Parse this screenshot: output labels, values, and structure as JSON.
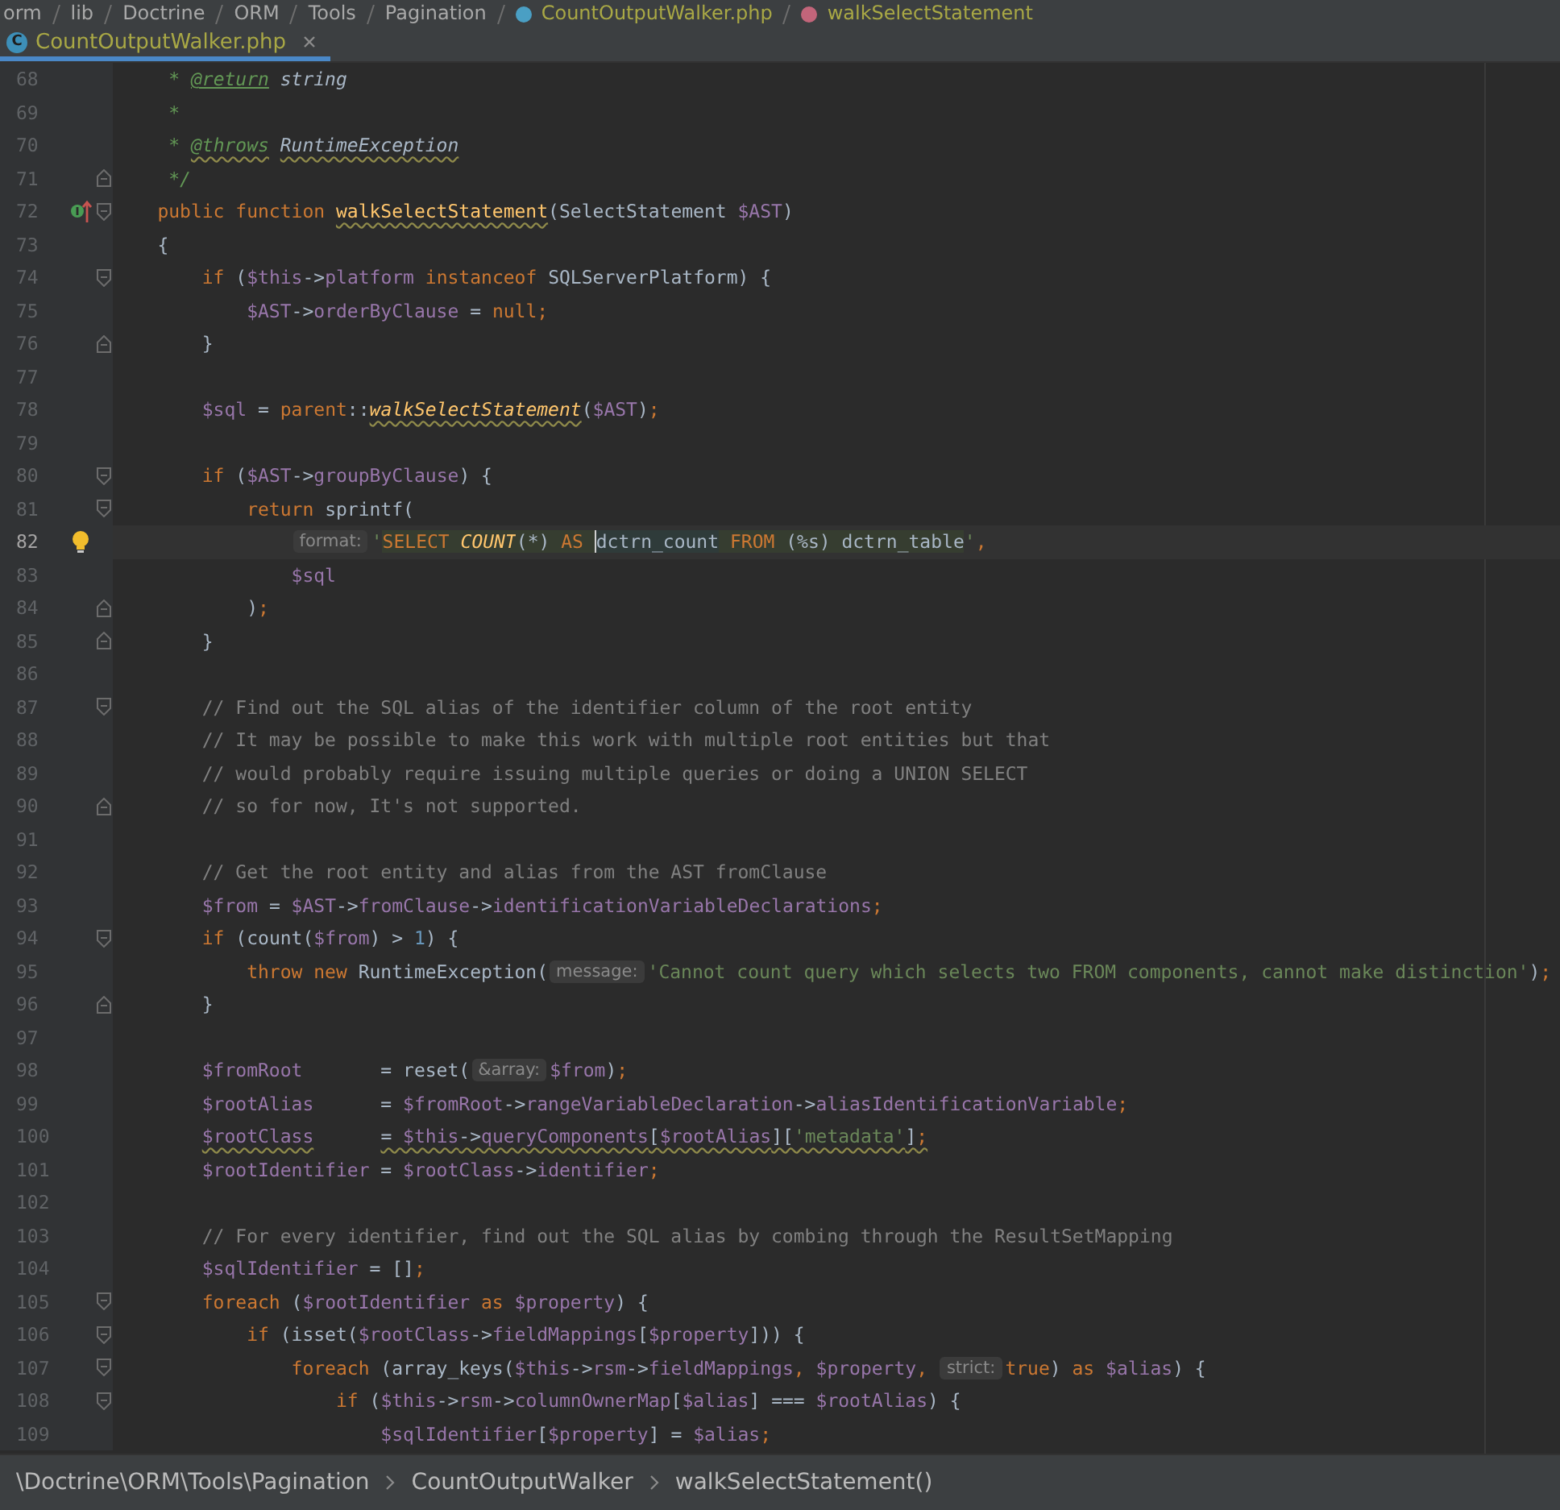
{
  "navigation_bar": {
    "items": [
      {
        "label": "orm",
        "kind": "folder"
      },
      {
        "label": "lib",
        "kind": "folder"
      },
      {
        "label": "Doctrine",
        "kind": "folder"
      },
      {
        "label": "ORM",
        "kind": "folder"
      },
      {
        "label": "Tools",
        "kind": "folder"
      },
      {
        "label": "Pagination",
        "kind": "folder"
      },
      {
        "label": "CountOutputWalker.php",
        "kind": "file"
      },
      {
        "label": "walkSelectStatement",
        "kind": "method"
      }
    ]
  },
  "tabs": [
    {
      "label": "CountOutputWalker.php",
      "icon_letter": "C",
      "selected": true
    }
  ],
  "editor": {
    "lines": [
      {
        "number": "68",
        "tokens": [
          {
            "kind": "doc",
            "text": "     * "
          },
          {
            "kind": "doctag",
            "text": "@return"
          },
          {
            "kind": "doctype",
            "text": " string"
          }
        ]
      },
      {
        "number": "69",
        "tokens": [
          {
            "kind": "doc",
            "text": "     *"
          }
        ]
      },
      {
        "number": "70",
        "tokens": [
          {
            "kind": "doc",
            "text": "     * "
          },
          {
            "kind": "doctag",
            "text": "@throws",
            "warning": true
          },
          {
            "kind": "doctype",
            "text": " RuntimeException",
            "warning": true
          }
        ]
      },
      {
        "number": "71",
        "fold_end": true,
        "tokens": [
          {
            "kind": "doc",
            "text": "     */"
          }
        ]
      },
      {
        "number": "72",
        "fold_start": true,
        "implements_marker": true,
        "tokens": [
          {
            "kind": "keyword",
            "text": "    public function "
          },
          {
            "kind": "declaration",
            "text": "walkSelectStatement",
            "warning": true
          },
          {
            "kind": "plain",
            "text": "(SelectStatement "
          },
          {
            "kind": "variable",
            "text": "$AST"
          },
          {
            "kind": "plain",
            "text": ")"
          }
        ]
      },
      {
        "number": "73",
        "tokens": [
          {
            "kind": "plain",
            "text": "    {"
          }
        ]
      },
      {
        "number": "74",
        "fold_start": true,
        "tokens": [
          {
            "kind": "keyword",
            "text": "        if "
          },
          {
            "kind": "plain",
            "text": "("
          },
          {
            "kind": "variable",
            "text": "$this"
          },
          {
            "kind": "plain",
            "text": "->"
          },
          {
            "kind": "field",
            "text": "platform"
          },
          {
            "kind": "keyword",
            "text": " instanceof "
          },
          {
            "kind": "plain",
            "text": "SQLServerPlatform) {"
          }
        ]
      },
      {
        "number": "75",
        "tokens": [
          {
            "kind": "variable",
            "text": "            $AST"
          },
          {
            "kind": "plain",
            "text": "->"
          },
          {
            "kind": "field",
            "text": "orderByClause"
          },
          {
            "kind": "plain",
            "text": " = "
          },
          {
            "kind": "keyword",
            "text": "null"
          },
          {
            "kind": "punct",
            "text": ";"
          }
        ]
      },
      {
        "number": "76",
        "fold_end": true,
        "tokens": [
          {
            "kind": "plain",
            "text": "        }"
          }
        ]
      },
      {
        "number": "77"
      },
      {
        "number": "78",
        "tokens": [
          {
            "kind": "variable",
            "text": "        $sql"
          },
          {
            "kind": "plain",
            "text": " = "
          },
          {
            "kind": "keyword",
            "text": "parent"
          },
          {
            "kind": "plain",
            "text": "::"
          },
          {
            "kind": "call",
            "text": "walkSelectStatement",
            "warning": true
          },
          {
            "kind": "plain",
            "text": "("
          },
          {
            "kind": "variable",
            "text": "$AST"
          },
          {
            "kind": "plain",
            "text": ")"
          },
          {
            "kind": "punct",
            "text": ";"
          }
        ]
      },
      {
        "number": "79"
      },
      {
        "number": "80",
        "fold_start": true,
        "tokens": [
          {
            "kind": "keyword",
            "text": "        if "
          },
          {
            "kind": "plain",
            "text": "("
          },
          {
            "kind": "variable",
            "text": "$AST"
          },
          {
            "kind": "plain",
            "text": "->"
          },
          {
            "kind": "field",
            "text": "groupByClause"
          },
          {
            "kind": "plain",
            "text": ") {"
          }
        ]
      },
      {
        "number": "81",
        "fold_start": true,
        "tokens": [
          {
            "kind": "keyword",
            "text": "            return "
          },
          {
            "kind": "plain",
            "text": "sprintf("
          }
        ]
      },
      {
        "number": "82",
        "current": true,
        "intention_bulb": true,
        "tokens": [
          {
            "kind": "hint",
            "text": "format:"
          },
          {
            "kind": "string",
            "text": "'"
          },
          {
            "kind": "sqlkeyword",
            "text": "SELECT"
          },
          {
            "kind": "sqlfunction",
            "text": " COUNT"
          },
          {
            "kind": "sqltext",
            "text": "(*) "
          },
          {
            "kind": "sqlkeyword",
            "text": "AS "
          },
          {
            "kind": "sqlalias",
            "text": "dctrn_count",
            "caret": true
          },
          {
            "kind": "sqlkeyword",
            "text": " FROM"
          },
          {
            "kind": "sqltext",
            "text": " (%s) dctrn_table"
          },
          {
            "kind": "string",
            "text": "'"
          },
          {
            "kind": "punct",
            "text": ","
          }
        ]
      },
      {
        "number": "83",
        "tokens": [
          {
            "kind": "variable",
            "text": "                $sql"
          }
        ]
      },
      {
        "number": "84",
        "fold_end": true,
        "tokens": [
          {
            "kind": "plain",
            "text": "            )"
          },
          {
            "kind": "punct",
            "text": ";"
          }
        ]
      },
      {
        "number": "85",
        "fold_end": true,
        "tokens": [
          {
            "kind": "plain",
            "text": "        }"
          }
        ]
      },
      {
        "number": "86"
      },
      {
        "number": "87",
        "fold_start": true,
        "tokens": [
          {
            "kind": "comment",
            "text": "        // Find out the SQL alias of the identifier column of the root entity"
          }
        ]
      },
      {
        "number": "88",
        "tokens": [
          {
            "kind": "comment",
            "text": "        // It may be possible to make this work with multiple root entities but that"
          }
        ]
      },
      {
        "number": "89",
        "tokens": [
          {
            "kind": "comment",
            "text": "        // would probably require issuing multiple queries or doing a UNION SELECT"
          }
        ]
      },
      {
        "number": "90",
        "fold_end": true,
        "tokens": [
          {
            "kind": "comment",
            "text": "        // so for now, It's not supported."
          }
        ]
      },
      {
        "number": "91"
      },
      {
        "number": "92",
        "tokens": [
          {
            "kind": "comment",
            "text": "        // Get the root entity and alias from the AST fromClause"
          }
        ]
      },
      {
        "number": "93",
        "tokens": [
          {
            "kind": "variable",
            "text": "        $from"
          },
          {
            "kind": "plain",
            "text": " = "
          },
          {
            "kind": "variable",
            "text": "$AST"
          },
          {
            "kind": "plain",
            "text": "->"
          },
          {
            "kind": "field",
            "text": "fromClause"
          },
          {
            "kind": "plain",
            "text": "->"
          },
          {
            "kind": "field",
            "text": "identificationVariableDeclarations"
          },
          {
            "kind": "punct",
            "text": ";"
          }
        ]
      },
      {
        "number": "94",
        "fold_start": true,
        "tokens": [
          {
            "kind": "keyword",
            "text": "        if "
          },
          {
            "kind": "plain",
            "text": "(count("
          },
          {
            "kind": "variable",
            "text": "$from"
          },
          {
            "kind": "plain",
            "text": ") > "
          },
          {
            "kind": "number",
            "text": "1"
          },
          {
            "kind": "plain",
            "text": ") {"
          }
        ]
      },
      {
        "number": "95",
        "tokens": [
          {
            "kind": "keyword",
            "text": "            throw new "
          },
          {
            "kind": "plain",
            "text": "RuntimeException("
          },
          {
            "kind": "hint",
            "text": "message:"
          },
          {
            "kind": "string",
            "text": "'Cannot count query which selects two FROM components, cannot make distinction'"
          },
          {
            "kind": "plain",
            "text": ")"
          },
          {
            "kind": "punct",
            "text": ";"
          }
        ]
      },
      {
        "number": "96",
        "fold_end": true,
        "tokens": [
          {
            "kind": "plain",
            "text": "        }"
          }
        ]
      },
      {
        "number": "97"
      },
      {
        "number": "98",
        "tokens": [
          {
            "kind": "variable",
            "text": "        $fromRoot"
          },
          {
            "kind": "plain",
            "text": "       = reset("
          },
          {
            "kind": "hint",
            "text": "&array:"
          },
          {
            "kind": "variable",
            "text": "$from"
          },
          {
            "kind": "plain",
            "text": ")"
          },
          {
            "kind": "punct",
            "text": ";"
          }
        ]
      },
      {
        "number": "99",
        "tokens": [
          {
            "kind": "variable",
            "text": "        $rootAlias"
          },
          {
            "kind": "plain",
            "text": "      = "
          },
          {
            "kind": "variable",
            "text": "$fromRoot"
          },
          {
            "kind": "plain",
            "text": "->"
          },
          {
            "kind": "field",
            "text": "rangeVariableDeclaration"
          },
          {
            "kind": "plain",
            "text": "->"
          },
          {
            "kind": "field",
            "text": "aliasIdentificationVariable"
          },
          {
            "kind": "punct",
            "text": ";"
          }
        ]
      },
      {
        "number": "100",
        "tokens": [
          {
            "kind": "variable",
            "text": "        $rootClass",
            "warning": true
          },
          {
            "kind": "plain",
            "text": "      = ",
            "warning": true
          },
          {
            "kind": "variable",
            "text": "$this",
            "warning": true
          },
          {
            "kind": "plain",
            "text": "->",
            "warning": true
          },
          {
            "kind": "field",
            "text": "queryComponents",
            "warning": true
          },
          {
            "kind": "plain",
            "text": "[",
            "warning": true
          },
          {
            "kind": "variable",
            "text": "$rootAlias",
            "warning": true
          },
          {
            "kind": "plain",
            "text": "][",
            "warning": true
          },
          {
            "kind": "string",
            "text": "'metadata'",
            "warning": true
          },
          {
            "kind": "plain",
            "text": "]",
            "warning": true
          },
          {
            "kind": "punct",
            "text": ";",
            "warning": true
          }
        ]
      },
      {
        "number": "101",
        "tokens": [
          {
            "kind": "variable",
            "text": "        $rootIdentifier"
          },
          {
            "kind": "plain",
            "text": " = "
          },
          {
            "kind": "variable",
            "text": "$rootClass"
          },
          {
            "kind": "plain",
            "text": "->"
          },
          {
            "kind": "field",
            "text": "identifier"
          },
          {
            "kind": "punct",
            "text": ";"
          }
        ]
      },
      {
        "number": "102"
      },
      {
        "number": "103",
        "tokens": [
          {
            "kind": "comment",
            "text": "        // For every identifier, find out the SQL alias by combing through the ResultSetMapping"
          }
        ]
      },
      {
        "number": "104",
        "tokens": [
          {
            "kind": "variable",
            "text": "        $sqlIdentifier"
          },
          {
            "kind": "plain",
            "text": " = []"
          },
          {
            "kind": "punct",
            "text": ";"
          }
        ]
      },
      {
        "number": "105",
        "fold_start": true,
        "tokens": [
          {
            "kind": "keyword",
            "text": "        foreach "
          },
          {
            "kind": "plain",
            "text": "("
          },
          {
            "kind": "variable",
            "text": "$rootIdentifier"
          },
          {
            "kind": "keyword",
            "text": " as "
          },
          {
            "kind": "variable",
            "text": "$property"
          },
          {
            "kind": "plain",
            "text": ") {"
          }
        ]
      },
      {
        "number": "106",
        "fold_start": true,
        "tokens": [
          {
            "kind": "keyword",
            "text": "            if "
          },
          {
            "kind": "plain",
            "text": "(isset("
          },
          {
            "kind": "variable",
            "text": "$rootClass"
          },
          {
            "kind": "plain",
            "text": "->"
          },
          {
            "kind": "field",
            "text": "fieldMappings"
          },
          {
            "kind": "plain",
            "text": "["
          },
          {
            "kind": "variable",
            "text": "$property"
          },
          {
            "kind": "plain",
            "text": "])) {"
          }
        ]
      },
      {
        "number": "107",
        "fold_start": true,
        "tokens": [
          {
            "kind": "keyword",
            "text": "                foreach "
          },
          {
            "kind": "plain",
            "text": "(array_keys("
          },
          {
            "kind": "variable",
            "text": "$this"
          },
          {
            "kind": "plain",
            "text": "->"
          },
          {
            "kind": "field",
            "text": "rsm"
          },
          {
            "kind": "plain",
            "text": "->"
          },
          {
            "kind": "field",
            "text": "fieldMappings"
          },
          {
            "kind": "punct",
            "text": ", "
          },
          {
            "kind": "variable",
            "text": "$property"
          },
          {
            "kind": "punct",
            "text": ", "
          },
          {
            "kind": "hint",
            "text": "strict:"
          },
          {
            "kind": "keyword",
            "text": "true"
          },
          {
            "kind": "plain",
            "text": ")"
          },
          {
            "kind": "keyword",
            "text": " as "
          },
          {
            "kind": "variable",
            "text": "$alias"
          },
          {
            "kind": "plain",
            "text": ") {"
          }
        ]
      },
      {
        "number": "108",
        "fold_start": true,
        "tokens": [
          {
            "kind": "keyword",
            "text": "                    if "
          },
          {
            "kind": "plain",
            "text": "("
          },
          {
            "kind": "variable",
            "text": "$this"
          },
          {
            "kind": "plain",
            "text": "->"
          },
          {
            "kind": "field",
            "text": "rsm"
          },
          {
            "kind": "plain",
            "text": "->"
          },
          {
            "kind": "field",
            "text": "columnOwnerMap"
          },
          {
            "kind": "plain",
            "text": "["
          },
          {
            "kind": "variable",
            "text": "$alias"
          },
          {
            "kind": "plain",
            "text": "] === "
          },
          {
            "kind": "variable",
            "text": "$rootAlias"
          },
          {
            "kind": "plain",
            "text": ") {"
          }
        ]
      },
      {
        "number": "109",
        "tokens": [
          {
            "kind": "variable",
            "text": "                        $sqlIdentifier"
          },
          {
            "kind": "plain",
            "text": "["
          },
          {
            "kind": "variable",
            "text": "$property"
          },
          {
            "kind": "plain",
            "text": "] = "
          },
          {
            "kind": "variable",
            "text": "$alias"
          },
          {
            "kind": "punct",
            "text": ";"
          }
        ]
      }
    ]
  },
  "breadcrumbs": [
    {
      "label": "\\Doctrine\\ORM\\Tools\\Pagination"
    },
    {
      "label": "CountOutputWalker"
    },
    {
      "label": "walkSelectStatement()"
    }
  ]
}
